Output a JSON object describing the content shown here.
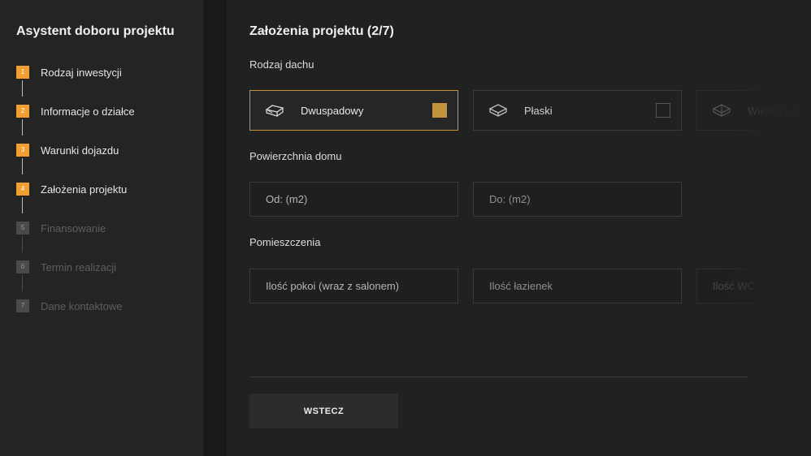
{
  "sidebar": {
    "title": "Asystent doboru projektu",
    "steps": [
      {
        "num": "1",
        "label": "Rodzaj inwestycji",
        "active": true
      },
      {
        "num": "2",
        "label": "Informacje o działce",
        "active": true
      },
      {
        "num": "3",
        "label": "Warunki dojazdu",
        "active": true
      },
      {
        "num": "4",
        "label": "Założenia projektu",
        "active": true
      },
      {
        "num": "5",
        "label": "Finansowanie",
        "active": false
      },
      {
        "num": "6",
        "label": "Termin realizacji",
        "active": false
      },
      {
        "num": "7",
        "label": "Dane kontaktowe",
        "active": false
      }
    ]
  },
  "main": {
    "title": "Założenia projektu (2/7)",
    "roof": {
      "label": "Rodzaj dachu",
      "options": [
        {
          "label": "Dwuspadowy",
          "selected": true,
          "icon": "gable-roof-icon"
        },
        {
          "label": "Płaski",
          "selected": false,
          "icon": "flat-roof-icon"
        },
        {
          "label": "Wielospadowy",
          "selected": false,
          "icon": "hip-roof-icon"
        }
      ]
    },
    "area": {
      "label": "Powierzchnia domu",
      "from_placeholder": "Od: (m2)",
      "to_placeholder": "Do: (m2)"
    },
    "rooms": {
      "label": "Pomieszczenia",
      "rooms_placeholder": "Ilość pokoi (wraz z salonem)",
      "bathrooms_placeholder": "Ilość łazienek",
      "wc_placeholder": "Ilość WC"
    },
    "back_label": "WSTECZ"
  },
  "colors": {
    "accent": "#f0a030",
    "selected_border": "#c49340",
    "background": "#212121",
    "sidebar_background": "#242424"
  }
}
